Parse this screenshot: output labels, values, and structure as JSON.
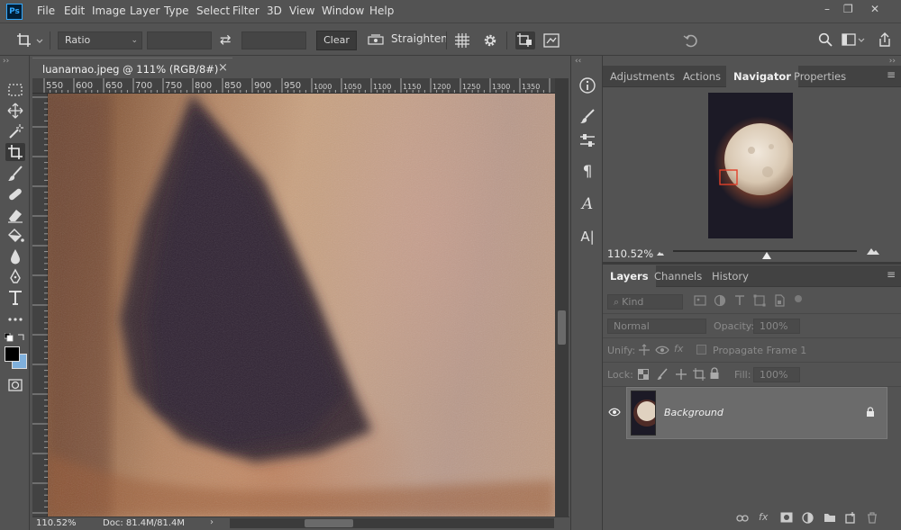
{
  "app": {
    "logo": "Ps",
    "window_controls": [
      "–",
      "❐",
      "✕"
    ]
  },
  "menu": [
    "File",
    "Edit",
    "Image",
    "Layer",
    "Type",
    "Select",
    "Filter",
    "3D",
    "View",
    "Window",
    "Help"
  ],
  "options": {
    "ratio_label": "Ratio",
    "swap_icon": "⇄",
    "clear_label": "Clear",
    "straighten_label": "Straighten"
  },
  "document": {
    "tab_title": "luanamao.jpeg @ 111% (RGB/8#)",
    "close_glyph": "×",
    "ruler_labels": [
      "550",
      "600",
      "650",
      "700",
      "750",
      "800",
      "850",
      "900",
      "950",
      "1000",
      "1050",
      "1100",
      "1150",
      "1200",
      "1250",
      "1300",
      "1350"
    ],
    "zoom": "110.52%",
    "doc_info": "Doc: 81.4M/81.4M",
    "status_arrow": "›"
  },
  "strip_icons": {
    "paragraph": "¶",
    "glyphs": "A",
    "character": "A|"
  },
  "top_panel": {
    "tabs": [
      "Adjustments",
      "Actions",
      "Navigator",
      "Properties"
    ],
    "active_tab": "Navigator",
    "navigator_zoom": "110.52%"
  },
  "layers_panel": {
    "tabs": [
      "Layers",
      "Channels",
      "History"
    ],
    "active_tab": "Layers",
    "filter_placeholder": "Kind",
    "blend_mode": "Normal",
    "opacity_label": "Opacity:",
    "opacity_value": "100%",
    "unify_label": "Unify:",
    "propagate_label": "Propagate Frame 1",
    "lock_label": "Lock:",
    "fill_label": "Fill:",
    "fill_value": "100%",
    "layers": [
      {
        "name": "Background",
        "visible": true,
        "locked": true
      }
    ]
  },
  "colors": {
    "ui_bg": "#535353",
    "panel_dark": "#424242",
    "accent": "#31a8ff",
    "nav_box": "#e0402a",
    "bg_swatch": "#7fb0dc"
  }
}
